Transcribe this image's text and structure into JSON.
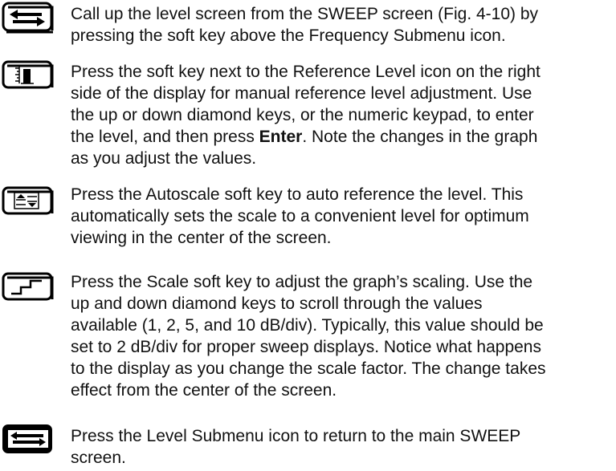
{
  "steps": [
    {
      "icon": "frequency-submenu-icon",
      "lines": [
        "Call up the level screen from the SWEEP screen (Fig. 4-10) by",
        "pressing the soft key above the Frequency Submenu icon."
      ]
    },
    {
      "icon": "reference-level-icon",
      "lines": [
        "Press the soft key next to the Reference Level icon on the right",
        "side of the display for manual reference level adjustment. Use",
        "the up or down diamond keys, or the numeric keypad, to enter"
      ],
      "line4_before": "the level, and then press ",
      "line4_bold": "Enter",
      "line4_after": ". Note the changes in the graph",
      "line5": "as you adjust the values."
    },
    {
      "icon": "autoscale-icon",
      "lines": [
        "Press the Autoscale soft key to auto reference the level. This",
        "automatically sets the scale to a convenient level for optimum",
        "viewing in the center of the screen."
      ]
    },
    {
      "icon": "scale-icon",
      "lines": [
        "Press the Scale soft key to adjust the graph’s scaling. Use the",
        "up and down diamond keys to scroll through the values",
        "available (1, 2, 5, and 10 dB/div). Typically, this value should be",
        "set to 2 dB/div for proper sweep displays. Notice what happens",
        "to the display as you change the scale factor. The change takes",
        "effect from the center of the screen."
      ]
    },
    {
      "icon": "level-submenu-icon",
      "lines": [
        "Press the Level Submenu icon to return to the main SWEEP",
        "screen."
      ]
    }
  ]
}
